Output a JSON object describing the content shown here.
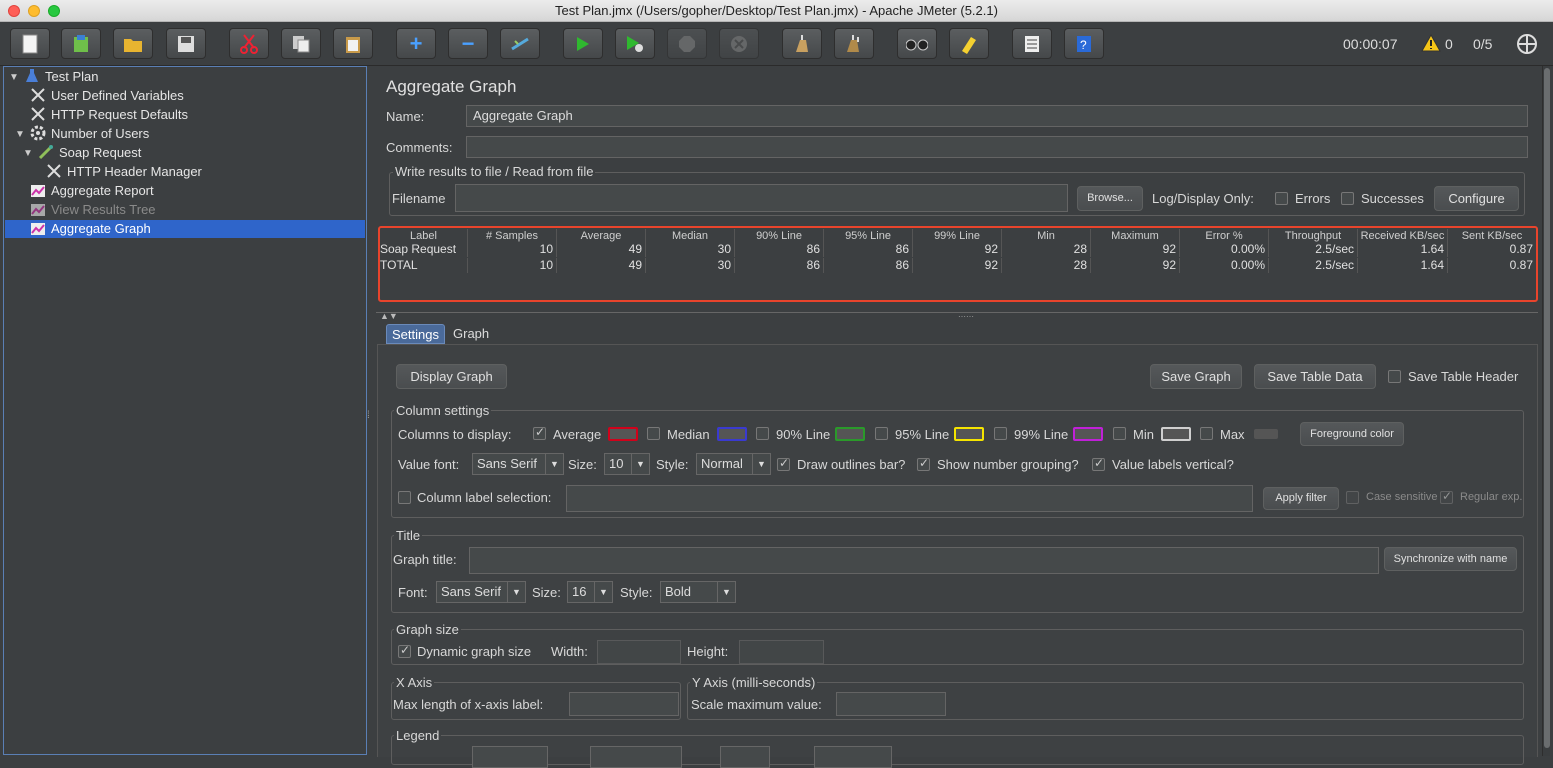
{
  "window": {
    "title": "Test Plan.jmx (/Users/gopher/Desktop/Test Plan.jmx) - Apache JMeter (5.2.1)"
  },
  "toolbar": {
    "timer": "00:00:07",
    "warnings": "0",
    "threads": "0/5"
  },
  "tree": {
    "items": [
      {
        "label": "Test Plan"
      },
      {
        "label": "User Defined Variables"
      },
      {
        "label": "HTTP Request Defaults"
      },
      {
        "label": "Number of Users"
      },
      {
        "label": "Soap Request"
      },
      {
        "label": "HTTP Header Manager"
      },
      {
        "label": "Aggregate Report"
      },
      {
        "label": "View Results Tree"
      },
      {
        "label": "Aggregate Graph"
      }
    ]
  },
  "panel": {
    "heading": "Aggregate Graph",
    "name_label": "Name:",
    "name_value": "Aggregate Graph",
    "comments_label": "Comments:",
    "file_group": "Write results to file / Read from file",
    "filename_label": "Filename",
    "browse": "Browse...",
    "log_display": "Log/Display Only:",
    "errors": "Errors",
    "successes": "Successes",
    "configure": "Configure"
  },
  "table": {
    "columns": [
      "Label",
      "# Samples",
      "Average",
      "Median",
      "90% Line",
      "95% Line",
      "99% Line",
      "Min",
      "Maximum",
      "Error %",
      "Throughput",
      "Received KB/sec",
      "Sent KB/sec"
    ],
    "rows": [
      [
        "Soap Request",
        "10",
        "49",
        "30",
        "86",
        "86",
        "92",
        "28",
        "92",
        "0.00%",
        "2.5/sec",
        "1.64",
        "0.87"
      ],
      [
        "TOTAL",
        "10",
        "49",
        "30",
        "86",
        "86",
        "92",
        "28",
        "92",
        "0.00%",
        "2.5/sec",
        "1.64",
        "0.87"
      ]
    ]
  },
  "tabs": {
    "settings": "Settings",
    "graph": "Graph"
  },
  "settings": {
    "display_graph": "Display Graph",
    "save_graph": "Save Graph",
    "save_table_data": "Save Table Data",
    "save_table_header": "Save Table Header",
    "column_settings": "Column settings",
    "columns_to_display": "Columns to display:",
    "average": "Average",
    "median": "Median",
    "line90": "90% Line",
    "line95": "95% Line",
    "line99": "99% Line",
    "min": "Min",
    "max": "Max",
    "foreground_color": "Foreground color",
    "value_font": "Value font:",
    "font_value": "Sans Serif",
    "size": "Size:",
    "size_value": "10",
    "style": "Style:",
    "style_value": "Normal",
    "draw_outlines": "Draw outlines bar?",
    "show_grouping": "Show number grouping?",
    "value_labels_vertical": "Value labels vertical?",
    "column_label_selection": "Column label selection:",
    "apply_filter": "Apply filter",
    "case_sensitive": "Case sensitive",
    "regular_exp": "Regular exp.",
    "title_group": "Title",
    "graph_title": "Graph title:",
    "sync_name": "Synchronize with name",
    "font": "Font:",
    "title_font_value": "Sans Serif",
    "title_size_value": "16",
    "title_style_value": "Bold",
    "graph_size": "Graph size",
    "dynamic_size": "Dynamic graph size",
    "width": "Width:",
    "height": "Height:",
    "x_axis": "X Axis",
    "max_length": "Max length of x-axis label:",
    "y_axis": "Y Axis (milli-seconds)",
    "scale_max": "Scale maximum value:",
    "legend": "Legend"
  },
  "colors": {
    "average": "#d0021b",
    "median": "#3a3ad0",
    "line90": "#2a9a2a",
    "line95": "#f5e400",
    "line99": "#c020d8",
    "min": "#cfcfcf",
    "max": "#555555",
    "highlight": "#e8442c"
  }
}
